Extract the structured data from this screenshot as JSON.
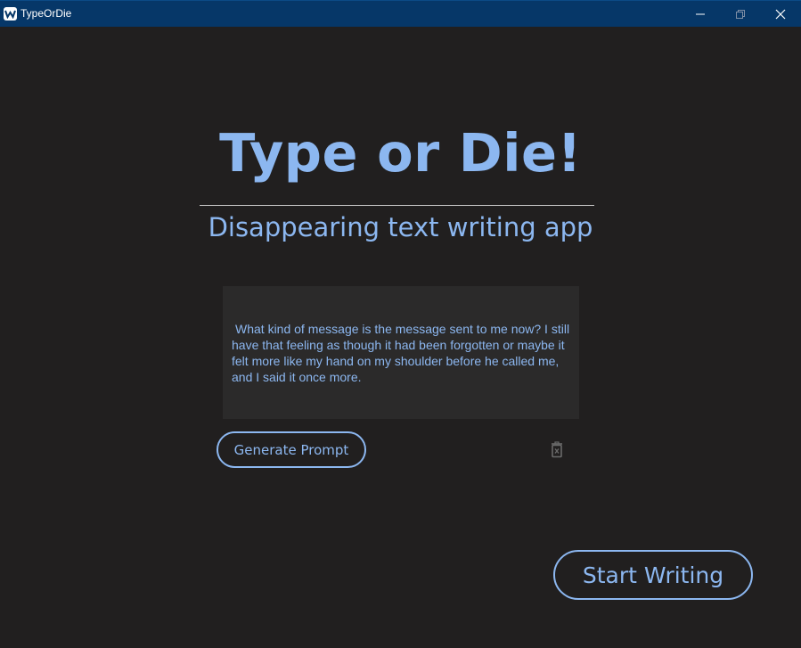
{
  "window": {
    "title": "TypeOrDie",
    "icon": "app-logo-icon"
  },
  "header": {
    "title": "Type or Die!",
    "subtitle": "Disappearing text writing app"
  },
  "prompt": {
    "text": "What kind of message is the message sent to me now? I still have that feeling as though it had been forgotten or maybe it felt more like my hand on my shoulder before he called me, and I said it once more."
  },
  "actions": {
    "generate_label": "Generate Prompt",
    "clear_icon": "trash-icon",
    "start_label": "Start Writing"
  },
  "colors": {
    "background": "#211f1f",
    "accent": "#8cb7f0",
    "titlebar": "#063768",
    "prompt_box": "#2b2a2a"
  }
}
